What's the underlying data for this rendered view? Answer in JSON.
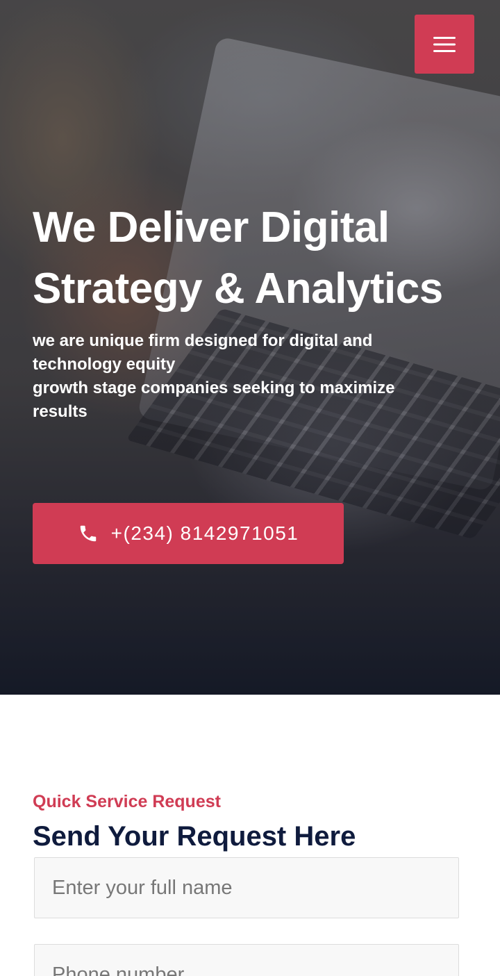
{
  "colors": {
    "accent": "#d03c54",
    "heading": "#0f1b3d"
  },
  "header": {
    "menu_icon": "hamburger-menu-icon"
  },
  "hero": {
    "title_line1": "We Deliver Digital",
    "title_line2": "Strategy & Analytics",
    "subtitle_line1": "we are unique firm designed for digital and",
    "subtitle_line2": "technology equity",
    "subtitle_line3": "growth stage companies seeking to maximize",
    "subtitle_line4": "results",
    "call_button": {
      "icon": "phone-icon",
      "label": "+(234) 8142971051"
    }
  },
  "request_form": {
    "eyebrow": "Quick Service Request",
    "title": "Send Your Request Here",
    "name_placeholder": "Enter your full name",
    "phone_placeholder": "Phone number"
  }
}
